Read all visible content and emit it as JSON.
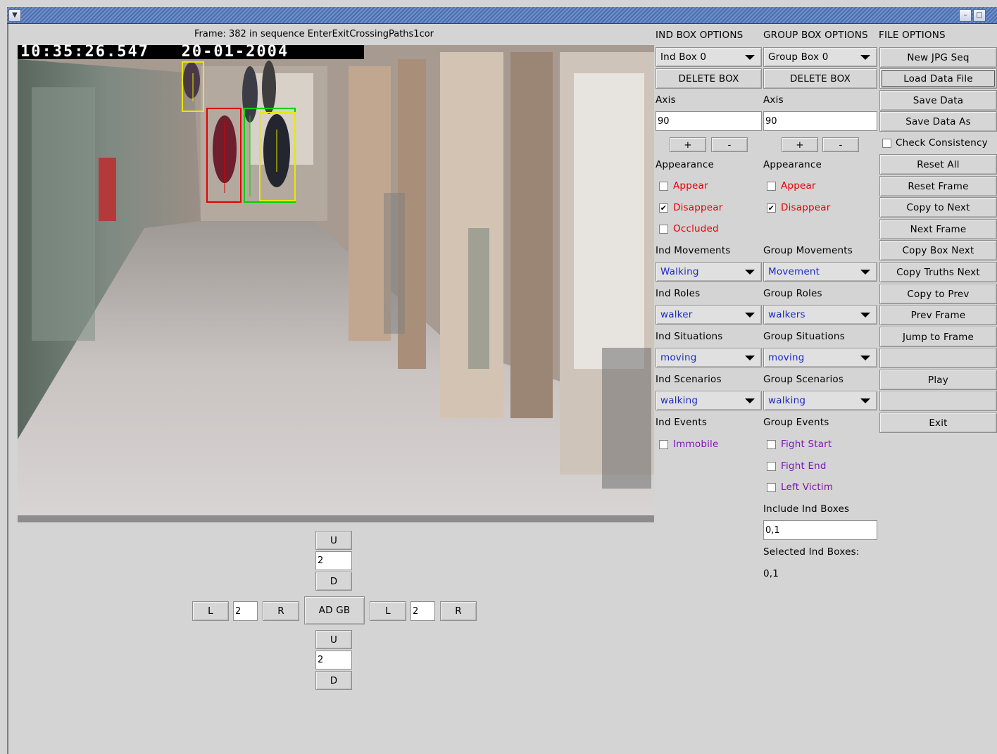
{
  "window": {
    "menu_icon": "chevron-down-icon",
    "controls": [
      "minimize-icon",
      "maximize-icon"
    ]
  },
  "frame_caption": "Frame: 382 in sequence EnterExitCrossingPaths1cor",
  "video": {
    "timestamp": "10:35:26.547   20-01-2004",
    "box_colors": [
      "#e8e800",
      "#e00000",
      "#00d000",
      "#e8e800"
    ]
  },
  "headers": {
    "ind": "IND BOX OPTIONS",
    "group": "GROUP BOX OPTIONS",
    "file": "FILE OPTIONS"
  },
  "ind": {
    "box_select": "Ind Box 0",
    "delete": "DELETE BOX",
    "axis_label": "Axis",
    "axis_value": "90",
    "plus": "+",
    "minus": "-",
    "appearance_label": "Appearance",
    "appear": "Appear",
    "disappear": "Disappear",
    "occluded": "Occluded",
    "appear_checked": false,
    "disappear_checked": true,
    "occluded_checked": false,
    "movements_label": "Ind Movements",
    "movement": "Walking",
    "roles_label": "Ind Roles",
    "role": "walker",
    "situations_label": "Ind Situations",
    "situation": "moving",
    "scenarios_label": "Ind Scenarios",
    "scenario": "walking",
    "events_label": "Ind Events",
    "immobile": "Immobile",
    "immobile_checked": false
  },
  "group": {
    "box_select": "Group Box 0",
    "delete": "DELETE BOX",
    "axis_label": "Axis",
    "axis_value": "90",
    "plus": "+",
    "minus": "-",
    "appearance_label": "Appearance",
    "appear": "Appear",
    "disappear": "Disappear",
    "appear_checked": false,
    "disappear_checked": true,
    "movements_label": "Group Movements",
    "movement": "Movement",
    "roles_label": "Group Roles",
    "role": "walkers",
    "situations_label": "Group Situations",
    "situation": "moving",
    "scenarios_label": "Group Scenarios",
    "scenario": "walking",
    "events_label": "Group Events",
    "fight_start": "Fight Start",
    "fight_end": "Fight End",
    "left_victim": "Left Victim",
    "include_label": "Include Ind Boxes",
    "include_value": "0,1",
    "selected_label": "Selected Ind Boxes:",
    "selected_value": "0,1"
  },
  "file": {
    "new_jpg_seq": "New JPG Seq",
    "load_data_file": "Load Data File",
    "save_data": "Save Data",
    "save_data_as": "Save Data As",
    "check_consistency": "Check Consistency",
    "check_consistency_checked": false,
    "reset_all": "Reset All",
    "reset_frame": "Reset Frame",
    "copy_to_next": "Copy to Next",
    "next_frame": "Next Frame",
    "copy_box_next": "Copy Box Next",
    "copy_truths_next": "Copy Truths Next",
    "copy_to_prev": "Copy to Prev",
    "prev_frame": "Prev Frame",
    "jump_to_frame": "Jump to Frame",
    "play": "Play",
    "exit": "Exit"
  },
  "nudge": {
    "up": "U",
    "down": "D",
    "left": "L",
    "right": "R",
    "center": "AD GB",
    "top_step": "2",
    "bottom_step": "2",
    "left_step": "2",
    "right_step": "2"
  }
}
